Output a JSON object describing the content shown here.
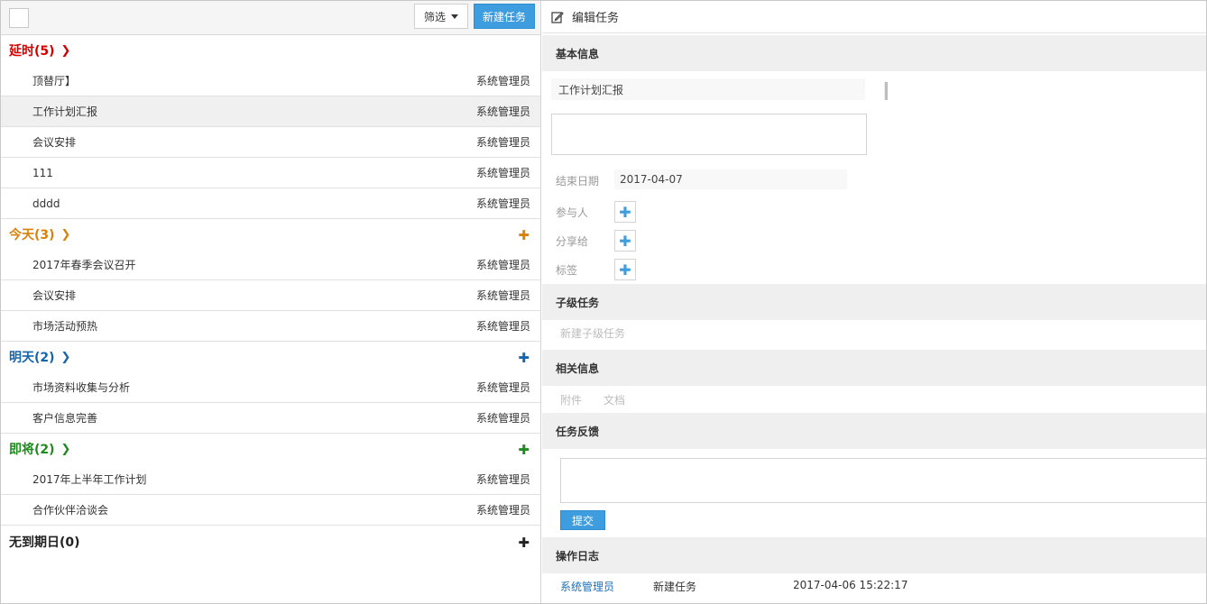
{
  "toolbar": {
    "filter_label": "筛选",
    "new_task_label": "新建任务"
  },
  "groups": [
    {
      "title": "延时(5)",
      "color": "#d40000",
      "tasks": [
        {
          "title": "顶替厅】",
          "owner": "系统管理员"
        },
        {
          "title": "工作计划汇报",
          "owner": "系统管理员",
          "selected": true
        },
        {
          "title": "会议安排",
          "owner": "系统管理员"
        },
        {
          "title": "111",
          "owner": "系统管理员"
        },
        {
          "title": "dddd",
          "owner": "系统管理员"
        }
      ]
    },
    {
      "title": "今天(3)",
      "color": "#d9820b",
      "tasks": [
        {
          "title": "2017年春季会议召开",
          "owner": "系统管理员"
        },
        {
          "title": "会议安排",
          "owner": "系统管理员"
        },
        {
          "title": "市场活动预热",
          "owner": "系统管理员"
        }
      ]
    },
    {
      "title": "明天(2)",
      "color": "#1565ad",
      "tasks": [
        {
          "title": "市场资料收集与分析",
          "owner": "系统管理员"
        },
        {
          "title": "客户信息完善",
          "owner": "系统管理员"
        }
      ]
    },
    {
      "title": "即将(2)",
      "color": "#1f8a1f",
      "tasks": [
        {
          "title": "2017年上半年工作计划",
          "owner": "系统管理员"
        },
        {
          "title": "合作伙伴洽谈会",
          "owner": "系统管理员"
        }
      ]
    },
    {
      "title": "无到期日(0)",
      "color": "#222222",
      "tasks": []
    }
  ],
  "editor": {
    "header_title": "编辑任务",
    "basic_info": "基本信息",
    "task_title_value": "工作计划汇报",
    "end_date_label": "结束日期",
    "end_date_value": "2017-04-07",
    "participants_label": "参与人",
    "share_label": "分享给",
    "tags_label": "标签",
    "subtasks_heading": "子级任务",
    "new_subtask_placeholder": "新建子级任务",
    "related_heading": "相关信息",
    "attachment_label": "附件",
    "document_label": "文档",
    "feedback_heading": "任务反馈",
    "submit_label": "提交",
    "log_heading": "操作日志",
    "log": [
      {
        "user": "系统管理员",
        "action": "新建任务",
        "time": "2017-04-06 15:22:17"
      }
    ]
  }
}
